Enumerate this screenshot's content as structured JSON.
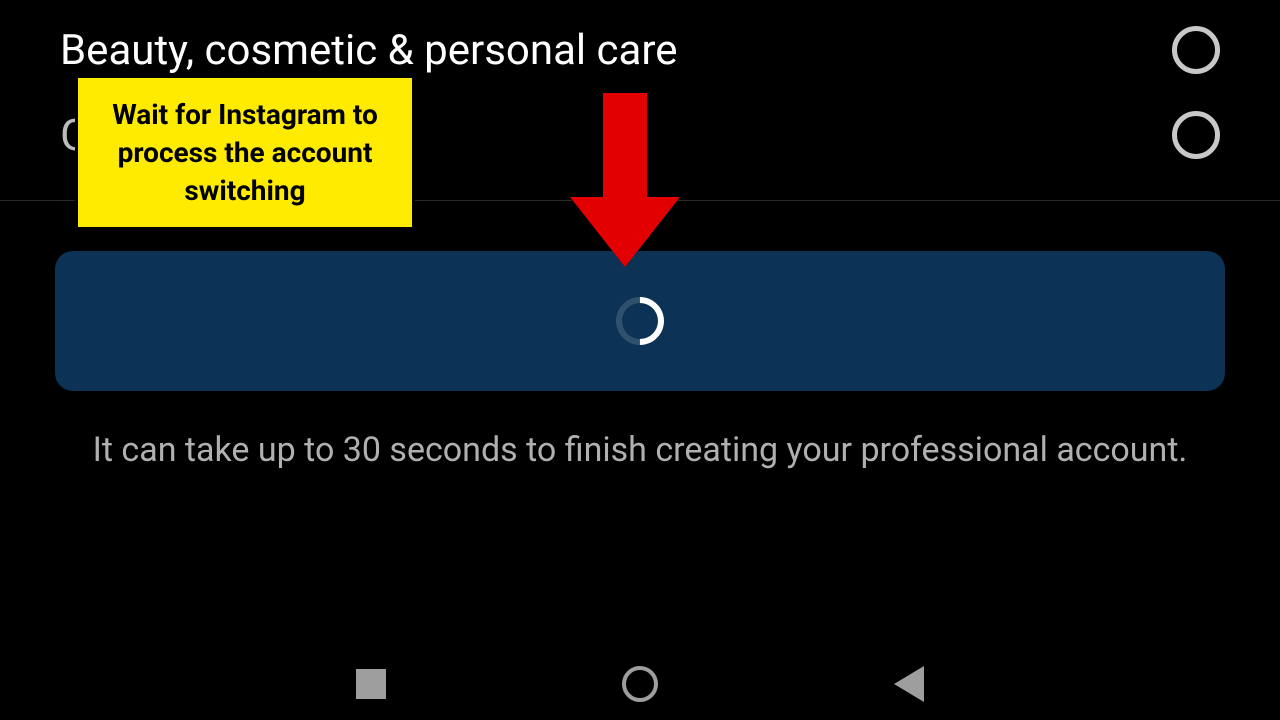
{
  "categories": [
    {
      "label": "Beauty, cosmetic & personal care"
    },
    {
      "label": "G"
    }
  ],
  "info_text": "It can take up to 30 seconds to finish creating your professional account.",
  "callout": {
    "text": "Wait for Instagram to process the account switching"
  }
}
